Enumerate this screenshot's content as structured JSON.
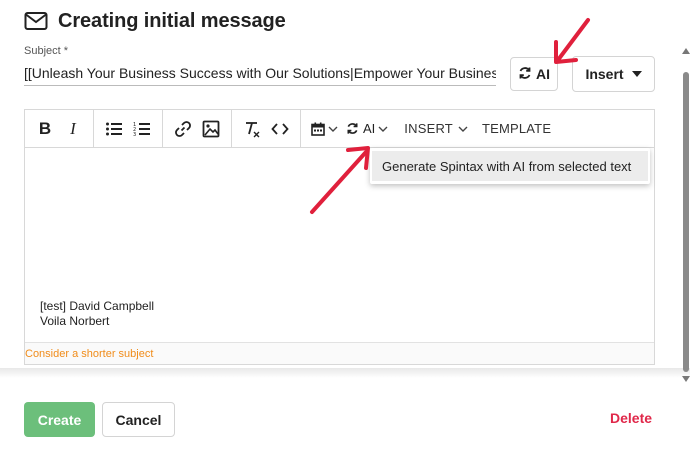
{
  "header": {
    "title": "Creating initial message",
    "icon": "mail-icon"
  },
  "subject": {
    "label": "Subject *",
    "value": "[[Unleash Your Business Success with Our Solutions|Empower Your Business"
  },
  "top_buttons": {
    "ai_label": "AI",
    "insert_label": "Insert"
  },
  "toolbar": {
    "bold": "B",
    "italic": "I",
    "ai_label": "AI",
    "insert_label": "INSERT",
    "template_label": "TEMPLATE"
  },
  "dropdown": {
    "item": "Generate Spintax with AI from selected text"
  },
  "editor": {
    "signature_line1": "[test] David Campbell",
    "signature_line2": "Voila Norbert",
    "warning": "Consider a shorter subject"
  },
  "footer": {
    "create_label": "Create",
    "cancel_label": "Cancel",
    "delete_label": "Delete"
  },
  "colors": {
    "create_green": "#6cbf7b",
    "delete_red": "#e0284a",
    "warning_orange": "#f08c1a",
    "arrow_red": "#e0203c"
  }
}
